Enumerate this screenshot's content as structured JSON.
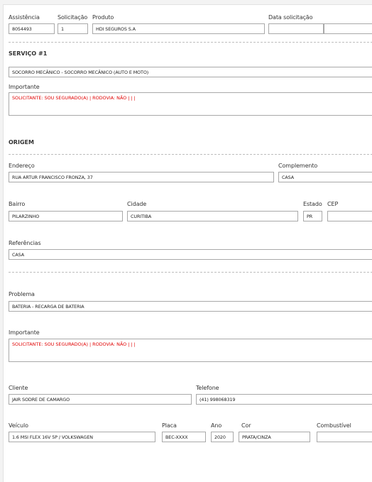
{
  "header": {
    "assistencia_label": "Assistência",
    "assistencia_value": "8054493",
    "solicitacao_label": "Solicitação",
    "solicitacao_value": "1",
    "produto_label": "Produto",
    "produto_value": "HDI SEGUROS S.A",
    "data_label": "Data solicitação",
    "data_value": "",
    "hora_value": ""
  },
  "servico": {
    "title": "SERVIÇO #1",
    "value": "SOCORRO MECÂNICO - SOCORRO MECÂNICO (AUTO E MOTO)",
    "importante_label": "Importante",
    "importante_value": "SOLICITANTE: SOU SEGURADO(A) | RODOVIA: NÃO |  |  |"
  },
  "origem": {
    "title": "ORIGEM",
    "endereco_label": "Endereço",
    "endereco_value": "RUA ARTUR FRANCISCO FRONZA, 37",
    "complemento_label": "Complemento",
    "complemento_value": "CASA",
    "bairro_label": "Bairro",
    "bairro_value": "PILARZINHO",
    "cidade_label": "Cidade",
    "cidade_value": "CURITIBA",
    "estado_label": "Estado",
    "estado_value": "PR",
    "cep_label": "CEP",
    "cep_value": "",
    "referencias_label": "Referências",
    "referencias_value": "CASA"
  },
  "problema": {
    "label": "Problema",
    "value": "BATERIA - RECARGA DE BATERIA",
    "importante_label": "Importante",
    "importante_value": "SOLICITANTE: SOU SEGURADO(A) | RODOVIA: NÃO |  |  |"
  },
  "cliente": {
    "cliente_label": "Cliente",
    "cliente_value": "JAIR SODRE DE CAMARGO",
    "telefone_label": "Telefone",
    "telefone_value": "(41) 998068319"
  },
  "veiculo": {
    "veiculo_label": "Veículo",
    "veiculo_value": "1.6 MSI FLEX 16V 5P / VOLKSWAGEN",
    "placa_label": "Placa",
    "placa_value": "BEC-XXXX",
    "ano_label": "Ano",
    "ano_value": "2020",
    "cor_label": "Cor",
    "cor_value": "PRATA/CINZA",
    "combustivel_label": "Combustível",
    "combustivel_value": ""
  }
}
